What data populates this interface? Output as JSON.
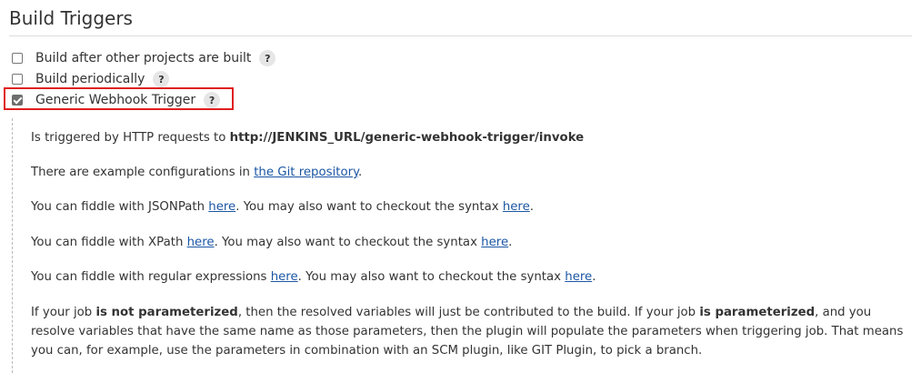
{
  "section": {
    "title": "Build Triggers"
  },
  "triggers": [
    {
      "label": "Build after other projects are built",
      "checked": false,
      "help": "?"
    },
    {
      "label": "Build periodically",
      "checked": false,
      "help": "?"
    },
    {
      "label": "Generic Webhook Trigger",
      "checked": true,
      "help": "?"
    }
  ],
  "description": {
    "p1": {
      "text": "Is triggered by HTTP requests to ",
      "url": "http://JENKINS_URL/generic-webhook-trigger/invoke"
    },
    "p2": {
      "text": "There are example configurations in ",
      "link": "the Git repository",
      "end": "."
    },
    "p3": {
      "text": "You can fiddle with JSONPath ",
      "link1": "here",
      "mid": ". You may also want to checkout the syntax ",
      "link2": "here",
      "end": "."
    },
    "p4": {
      "text": "You can fiddle with XPath ",
      "link1": "here",
      "mid": ". You may also want to checkout the syntax ",
      "link2": "here",
      "end": "."
    },
    "p5": {
      "text": "You can fiddle with regular expressions ",
      "link1": "here",
      "mid": ". You may also want to checkout the syntax ",
      "link2": "here",
      "end": "."
    },
    "p6": {
      "a": "If your job ",
      "b": "is not parameterized",
      "c": ", then the resolved variables will just be contributed to the build. If your job ",
      "d": "is parameterized",
      "e": ", and you resolve variables that have the same name as those parameters, then the plugin will populate the parameters when triggering job. That means you can, for example, use the parameters in combination with an SCM plugin, like GIT Plugin, to pick a branch."
    }
  }
}
